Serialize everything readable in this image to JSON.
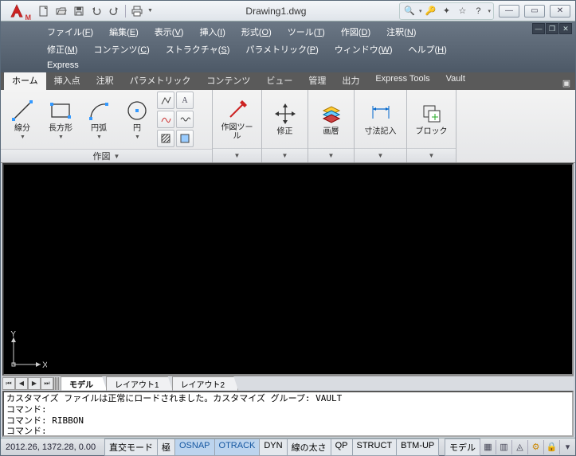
{
  "title": "Drawing1.dwg",
  "qat": {
    "tools": [
      "new",
      "open",
      "save",
      "undo",
      "redo",
      "print"
    ]
  },
  "menubar": {
    "row1": [
      {
        "label": "ファイル",
        "key": "F"
      },
      {
        "label": "編集",
        "key": "E"
      },
      {
        "label": "表示",
        "key": "V"
      },
      {
        "label": "挿入",
        "key": "I"
      },
      {
        "label": "形式",
        "key": "O"
      },
      {
        "label": "ツール",
        "key": "T"
      },
      {
        "label": "作図",
        "key": "D"
      },
      {
        "label": "注釈",
        "key": "N"
      }
    ],
    "row2": [
      {
        "label": "修正",
        "key": "M"
      },
      {
        "label": "コンテンツ",
        "key": "C"
      },
      {
        "label": "ストラクチャ",
        "key": "S"
      },
      {
        "label": "パラメトリック",
        "key": "P"
      },
      {
        "label": "ウィンドウ",
        "key": "W"
      },
      {
        "label": "ヘルプ",
        "key": "H"
      }
    ],
    "row3": [
      {
        "label": "Express",
        "key": ""
      }
    ]
  },
  "ribbon": {
    "tabs": [
      "ホーム",
      "挿入点",
      "注釈",
      "パラメトリック",
      "コンテンツ",
      "ビュー",
      "管理",
      "出力",
      "Express Tools",
      "Vault"
    ],
    "active": 0,
    "panels": {
      "draw": {
        "title": "作図",
        "items": [
          "線分",
          "長方形",
          "円弧",
          "円"
        ]
      },
      "drawtool": {
        "label": "作図ツール"
      },
      "modify": {
        "label": "修正"
      },
      "layer": {
        "label": "画層"
      },
      "dim": {
        "label": "寸法記入"
      },
      "block": {
        "label": "ブロック"
      }
    }
  },
  "sheets": {
    "tabs": [
      "モデル",
      "レイアウト1",
      "レイアウト2"
    ],
    "active": 0
  },
  "cmd": {
    "lines": [
      "カスタマイズ ファイルは正常にロードされました。カスタマイズ グループ: VAULT",
      "コマンド:",
      "コマンド: RIBBON",
      "コマンド:"
    ]
  },
  "status": {
    "coords": "2012.26, 1372.28, 0.00",
    "toggles": [
      {
        "label": "直交モード",
        "on": false
      },
      {
        "label": "極",
        "on": false
      },
      {
        "label": "OSNAP",
        "on": true
      },
      {
        "label": "OTRACK",
        "on": true
      },
      {
        "label": "DYN",
        "on": false
      },
      {
        "label": "線の太さ",
        "on": false
      },
      {
        "label": "QP",
        "on": false
      },
      {
        "label": "STRUCT",
        "on": false
      },
      {
        "label": "BTM-UP",
        "on": false
      }
    ],
    "space": "モデル"
  },
  "ucs": {
    "x": "X",
    "y": "Y"
  }
}
